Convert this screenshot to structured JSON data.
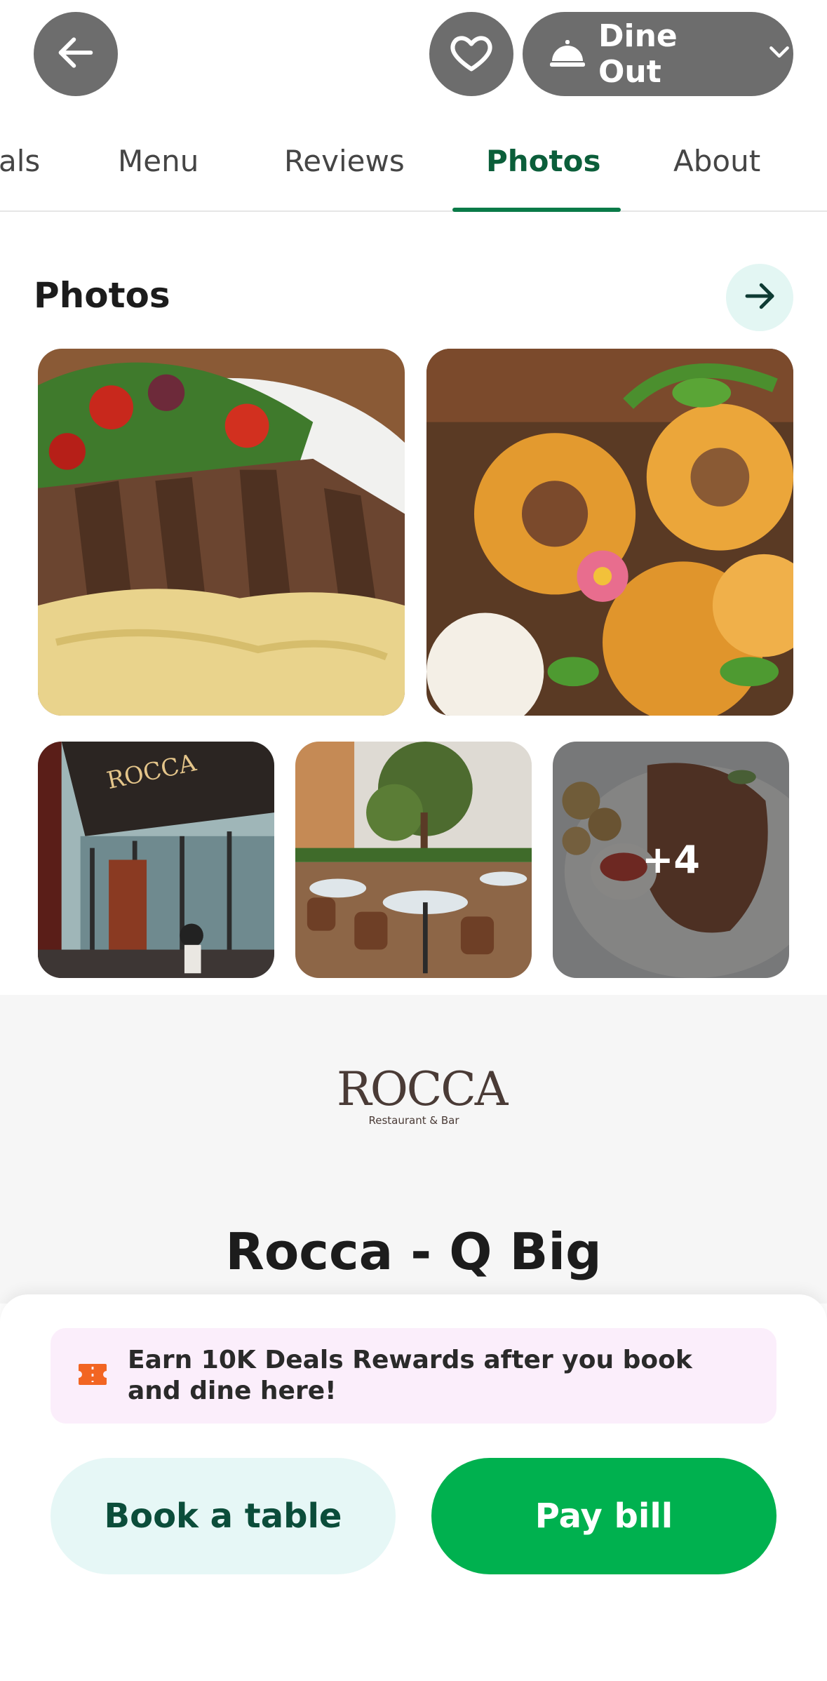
{
  "header": {
    "mode_label": "Dine Out"
  },
  "tabs": [
    {
      "label": "als"
    },
    {
      "label": "Menu"
    },
    {
      "label": "Reviews"
    },
    {
      "label": "Photos"
    },
    {
      "label": "About"
    }
  ],
  "photos_section": {
    "title": "Photos",
    "more_count": "+4"
  },
  "restaurant": {
    "logo_text": "ROCCA",
    "logo_tagline": "Restaurant & Bar",
    "name": "Rocca - Q Big"
  },
  "promo": {
    "text": "Earn 10K Deals Rewards after you book and dine here!"
  },
  "actions": {
    "book_label": "Book a table",
    "pay_label": "Pay bill"
  },
  "colors": {
    "accent_green": "#00b14f",
    "tab_active": "#0b5e3a",
    "promo_bg": "#fbeefb",
    "promo_icon": "#f26522"
  }
}
